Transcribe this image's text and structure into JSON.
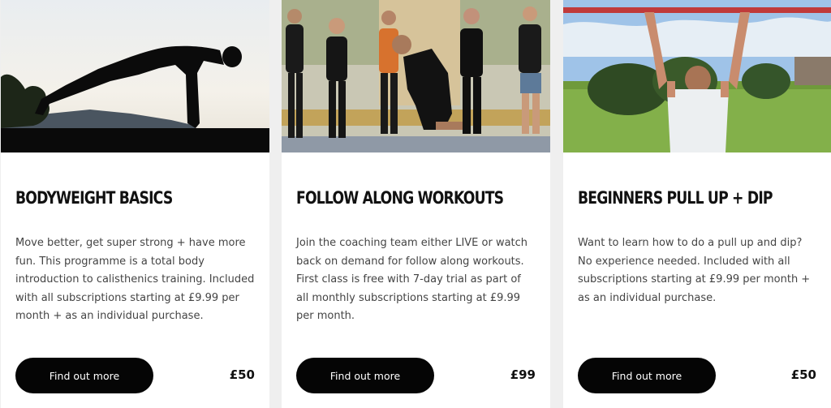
{
  "cards": [
    {
      "title": "BODYWEIGHT BASICS",
      "description": "Move better, get super strong + have more fun. This programme is a total body introduction to calisthenics training. Included with all subscriptions starting at £9.99 per month + as an individual purchase.",
      "button_label": "Find out more",
      "price": "£50"
    },
    {
      "title": "FOLLOW ALONG WORKOUTS",
      "description": "Join the coaching team either LIVE or watch back on demand for follow along workouts. First class is free with 7-day trial as part of all monthly subscriptions starting at £9.99 per month.",
      "button_label": "Find out more",
      "price": "£99"
    },
    {
      "title": "BEGINNERS PULL UP + DIP",
      "description": "Want to learn how to do a pull up and dip? No experience needed. Included with all subscriptions starting at £9.99 per month + as an individual purchase.",
      "button_label": "Find out more",
      "price": "£50"
    }
  ]
}
